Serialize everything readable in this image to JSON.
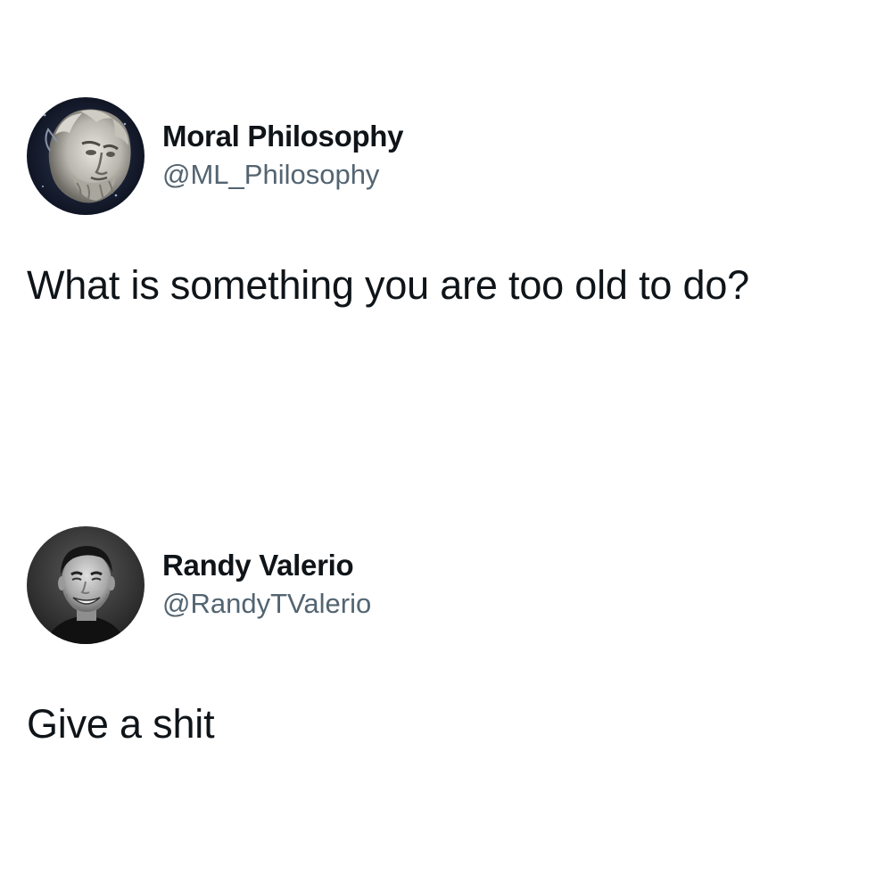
{
  "tweets": [
    {
      "display_name": "Moral Philosophy",
      "handle": "@ML_Philosophy",
      "text": "What is something you are too old to do?",
      "avatar_icon": "marble-statue-avatar"
    },
    {
      "display_name": "Randy Valerio",
      "handle": "@RandyTValerio",
      "text": "Give a shit",
      "avatar_icon": "man-portrait-avatar"
    }
  ],
  "colors": {
    "text_primary": "#0f1419",
    "text_secondary": "#536471",
    "background": "#ffffff"
  }
}
